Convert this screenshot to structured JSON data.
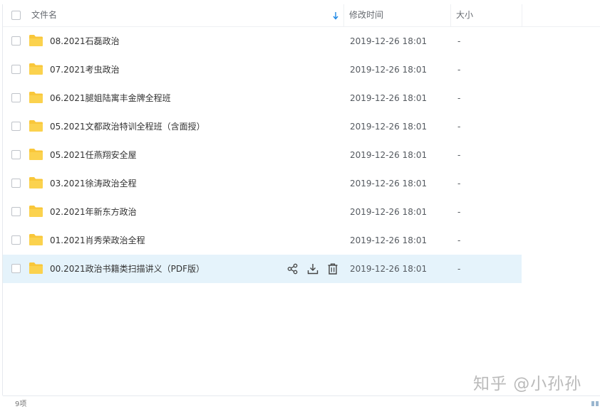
{
  "header": {
    "name_label": "文件名",
    "time_label": "修改时间",
    "size_label": "大小"
  },
  "rows": [
    {
      "name": "08.2021石磊政治",
      "time": "2019-12-26 18:01",
      "size": "-"
    },
    {
      "name": "07.2021考虫政治",
      "time": "2019-12-26 18:01",
      "size": "-"
    },
    {
      "name": "06.2021腿姐陆寓丰金牌全程班",
      "time": "2019-12-26 18:01",
      "size": "-"
    },
    {
      "name": "05.2021文都政治特训全程班（含面授）",
      "time": "2019-12-26 18:01",
      "size": "-"
    },
    {
      "name": "05.2021任燕翔安全屋",
      "time": "2019-12-26 18:01",
      "size": "-"
    },
    {
      "name": "03.2021徐涛政治全程",
      "time": "2019-12-26 18:01",
      "size": "-"
    },
    {
      "name": "02.2021年新东方政治",
      "time": "2019-12-26 18:01",
      "size": "-"
    },
    {
      "name": "01.2021肖秀荣政治全程",
      "time": "2019-12-26 18:01",
      "size": "-"
    },
    {
      "name": "00.2021政治书籍类扫描讲义（PDF版）",
      "time": "2019-12-26 18:01",
      "size": "-",
      "highlighted": true
    }
  ],
  "row_actions": {
    "share": "share-icon",
    "download": "download-icon",
    "delete": "trash-icon"
  },
  "footer": {
    "count_text": "9项"
  },
  "watermark": "知乎 @小孙孙",
  "colors": {
    "folder": "#f9c73a",
    "highlight_row": "#e5f3fb",
    "sort_arrow": "#1e88e5"
  }
}
